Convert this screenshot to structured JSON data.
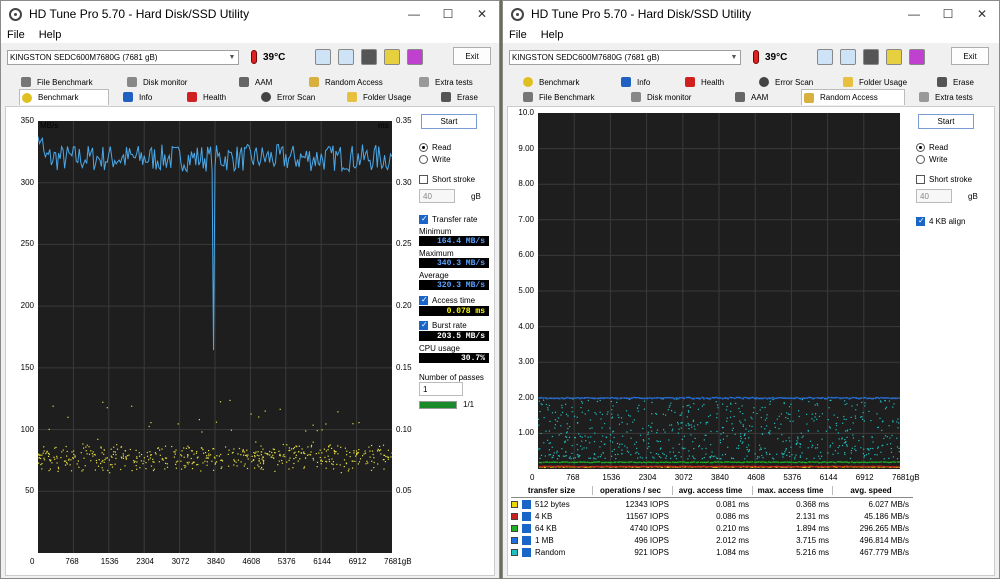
{
  "left": {
    "title": "HD Tune Pro 5.70 - Hard Disk/SSD Utility",
    "menu": [
      "File",
      "Help"
    ],
    "drive": "KINGSTON SEDC600M7680G (7681 gB)",
    "temperature": "39°C",
    "exit": "Exit",
    "tabs_row1": [
      "File Benchmark",
      "Disk monitor",
      "AAM",
      "Random Access",
      "Extra tests"
    ],
    "tabs_row2": [
      "Benchmark",
      "Info",
      "Health",
      "Error Scan",
      "Folder Usage",
      "Erase"
    ],
    "start": "Start",
    "read": "Read",
    "write": "Write",
    "short_stroke": "Short stroke",
    "stroke_value": "40",
    "gb": "gB",
    "transfer_rate": "Transfer rate",
    "minimum_label": "Minimum",
    "minimum": "164.4 MB/s",
    "maximum_label": "Maximum",
    "maximum": "340.3 MB/s",
    "average_label": "Average",
    "average": "320.3 MB/s",
    "access_time_label": "Access time",
    "access_time": "0.078 ms",
    "burst_rate_label": "Burst rate",
    "burst_rate": "203.5 MB/s",
    "cpu_usage_label": "CPU usage",
    "cpu_usage": "30.7%",
    "passes_label": "Number of passes",
    "passes_value": "1",
    "pass_progress_text": "1/1",
    "pass_progress": 1.0
  },
  "right": {
    "title": "HD Tune Pro 5.70 - Hard Disk/SSD Utility",
    "menu": [
      "File",
      "Help"
    ],
    "drive": "KINGSTON SEDC600M7680G (7681 gB)",
    "temperature": "39°C",
    "exit": "Exit",
    "tabs_row1": [
      "Benchmark",
      "Info",
      "Health",
      "Error Scan",
      "Folder Usage",
      "Erase"
    ],
    "tabs_row2": [
      "File Benchmark",
      "Disk monitor",
      "AAM",
      "Random Access",
      "Extra tests"
    ],
    "start": "Start",
    "read": "Read",
    "write": "Write",
    "short_stroke": "Short stroke",
    "stroke_value": "40",
    "gb": "gB",
    "align": "4 KB align",
    "table_headers": [
      "transfer size",
      "operations / sec",
      "avg. access time",
      "max. access time",
      "avg. speed"
    ],
    "table_rows": [
      {
        "size": "512 bytes",
        "ops": "12343 IOPS",
        "avg": "0.081 ms",
        "max": "0.368 ms",
        "speed": "6.027 MB/s",
        "color": "#e8d800"
      },
      {
        "size": "4 KB",
        "ops": "11567 IOPS",
        "avg": "0.086 ms",
        "max": "2.131 ms",
        "speed": "45.186 MB/s",
        "color": "#c62020"
      },
      {
        "size": "64 KB",
        "ops": "4740 IOPS",
        "avg": "0.210 ms",
        "max": "1.894 ms",
        "speed": "296.265 MB/s",
        "color": "#20b020"
      },
      {
        "size": "1 MB",
        "ops": "496 IOPS",
        "avg": "2.012 ms",
        "max": "3.715 ms",
        "speed": "496.814 MB/s",
        "color": "#2070e0"
      },
      {
        "size": "Random",
        "ops": "921 IOPS",
        "avg": "1.084 ms",
        "max": "5.216 ms",
        "speed": "467.779 MB/s",
        "color": "#20c0c0"
      }
    ]
  },
  "chart_data": [
    {
      "type": "line",
      "ylabel": "MB/s",
      "y2label": "ms",
      "ylim": [
        0,
        350
      ],
      "y2lim": [
        0,
        0.35
      ],
      "yticks": [
        "350",
        "300",
        "250",
        "200",
        "150",
        "100",
        "50"
      ],
      "y2ticks": [
        "0.35",
        "0.30",
        "0.25",
        "0.20",
        "0.15",
        "0.10",
        "0.05"
      ],
      "xticks": [
        "0",
        "768",
        "1536",
        "2304",
        "3072",
        "3840",
        "4608",
        "5376",
        "6144",
        "6912",
        "7681gB"
      ],
      "xlim": [
        0,
        7681
      ],
      "series": [
        {
          "name": "Transfer rate",
          "color": "#4aa8e8",
          "y_mean": 320,
          "y_min": 164.4,
          "y_max": 340.3,
          "dip_at_x": 3800
        },
        {
          "name": "Access time",
          "color": "#e8e040",
          "y_range": [
            0.065,
            0.09
          ]
        }
      ]
    },
    {
      "type": "scatter",
      "ylim": [
        0,
        10
      ],
      "yticks": [
        "10.0",
        "9.00",
        "8.00",
        "7.00",
        "6.00",
        "5.00",
        "4.00",
        "3.00",
        "2.00",
        "1.00"
      ],
      "xticks": [
        "0",
        "768",
        "1536",
        "2304",
        "3072",
        "3840",
        "4608",
        "5376",
        "6144",
        "6912",
        "7681gB"
      ],
      "xlim": [
        0,
        7681
      ],
      "series": [
        {
          "name": "512 bytes",
          "color": "#e8d800",
          "y_level": 0.08
        },
        {
          "name": "4 KB",
          "color": "#c62020",
          "y_level": 0.09
        },
        {
          "name": "64 KB",
          "color": "#20b020",
          "y_level": 0.21
        },
        {
          "name": "1 MB",
          "color": "#2070e0",
          "y_level": 2.01
        },
        {
          "name": "Random",
          "color": "#20c0c0",
          "y_range": [
            0.3,
            2.0
          ]
        }
      ]
    }
  ]
}
